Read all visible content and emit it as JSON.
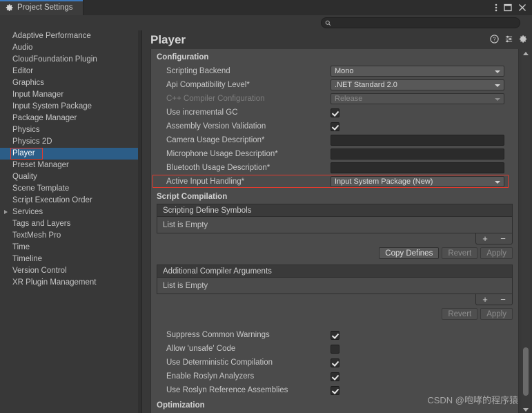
{
  "window": {
    "tab_label": "Project Settings",
    "tab_icon": "gear-icon",
    "controls": [
      {
        "name": "more-options-icon",
        "glyph": "kebab-menu"
      },
      {
        "name": "maximize-icon",
        "glyph": "square"
      },
      {
        "name": "close-icon",
        "glyph": "x"
      }
    ]
  },
  "search": {
    "icon": "search-icon",
    "value": "",
    "placeholder": ""
  },
  "sidebar": {
    "items": [
      {
        "label": "Adaptive Performance",
        "selected": false,
        "expandable": false
      },
      {
        "label": "Audio",
        "selected": false,
        "expandable": false
      },
      {
        "label": "CloudFoundation Plugin",
        "selected": false,
        "expandable": false
      },
      {
        "label": "Editor",
        "selected": false,
        "expandable": false
      },
      {
        "label": "Graphics",
        "selected": false,
        "expandable": false
      },
      {
        "label": "Input Manager",
        "selected": false,
        "expandable": false
      },
      {
        "label": "Input System Package",
        "selected": false,
        "expandable": false
      },
      {
        "label": "Package Manager",
        "selected": false,
        "expandable": false
      },
      {
        "label": "Physics",
        "selected": false,
        "expandable": false
      },
      {
        "label": "Physics 2D",
        "selected": false,
        "expandable": false
      },
      {
        "label": "Player",
        "selected": true,
        "expandable": false,
        "annotated": true
      },
      {
        "label": "Preset Manager",
        "selected": false,
        "expandable": false
      },
      {
        "label": "Quality",
        "selected": false,
        "expandable": false
      },
      {
        "label": "Scene Template",
        "selected": false,
        "expandable": false
      },
      {
        "label": "Script Execution Order",
        "selected": false,
        "expandable": false
      },
      {
        "label": "Services",
        "selected": false,
        "expandable": true
      },
      {
        "label": "Tags and Layers",
        "selected": false,
        "expandable": false
      },
      {
        "label": "TextMesh Pro",
        "selected": false,
        "expandable": false
      },
      {
        "label": "Time",
        "selected": false,
        "expandable": false
      },
      {
        "label": "Timeline",
        "selected": false,
        "expandable": false
      },
      {
        "label": "Version Control",
        "selected": false,
        "expandable": false
      },
      {
        "label": "XR Plugin Management",
        "selected": false,
        "expandable": false
      }
    ]
  },
  "panel": {
    "title": "Player",
    "header_icons": [
      {
        "name": "help-icon"
      },
      {
        "name": "preset-icon"
      },
      {
        "name": "settings-gear-icon"
      }
    ],
    "configuration": {
      "heading": "Configuration",
      "rows": [
        {
          "label": "Scripting Backend",
          "type": "dropdown",
          "value": "Mono",
          "disabled": false
        },
        {
          "label": "Api Compatibility Level*",
          "type": "dropdown",
          "value": ".NET Standard 2.0",
          "disabled": false
        },
        {
          "label": "C++ Compiler Configuration",
          "type": "dropdown",
          "value": "Release",
          "disabled": true
        },
        {
          "label": "Use incremental GC",
          "type": "checkbox",
          "checked": true,
          "disabled": false
        },
        {
          "label": "Assembly Version Validation",
          "type": "checkbox",
          "checked": true,
          "disabled": false
        },
        {
          "label": "Camera Usage Description*",
          "type": "text",
          "value": "",
          "disabled": false
        },
        {
          "label": "Microphone Usage Description*",
          "type": "text",
          "value": "",
          "disabled": false
        },
        {
          "label": "Bluetooth Usage Description*",
          "type": "text",
          "value": "",
          "disabled": false
        },
        {
          "label": "Active Input Handling*",
          "type": "dropdown",
          "value": "Input System Package (New)",
          "disabled": false,
          "annotated": true
        }
      ]
    },
    "script_compilation": {
      "heading": "Script Compilation",
      "define_symbols": {
        "list_title": "Scripting Define Symbols",
        "empty_text": "List is Empty",
        "add_label": "+",
        "remove_label": "−",
        "buttons": [
          {
            "label": "Copy Defines",
            "enabled": true
          },
          {
            "label": "Revert",
            "enabled": false
          },
          {
            "label": "Apply",
            "enabled": false
          }
        ]
      },
      "compiler_arguments": {
        "list_title": "Additional Compiler Arguments",
        "empty_text": "List is Empty",
        "add_label": "+",
        "remove_label": "−",
        "buttons": [
          {
            "label": "Revert",
            "enabled": false
          },
          {
            "label": "Apply",
            "enabled": false
          }
        ]
      },
      "toggles": [
        {
          "label": "Suppress Common Warnings",
          "checked": true
        },
        {
          "label": "Allow 'unsafe' Code",
          "checked": false
        },
        {
          "label": "Use Deterministic Compilation",
          "checked": true
        },
        {
          "label": "Enable Roslyn Analyzers",
          "checked": true
        },
        {
          "label": "Use Roslyn Reference Assemblies",
          "checked": true
        }
      ]
    },
    "optimization_heading": "Optimization"
  },
  "watermark": "CSDN @咆哮的程序猿",
  "colors": {
    "accent_blue": "#3b78bd",
    "selection_blue": "#2c5d87",
    "annotation_red": "#e23b2e",
    "panel_bg": "#4b4b4b",
    "window_bg": "#383838"
  }
}
